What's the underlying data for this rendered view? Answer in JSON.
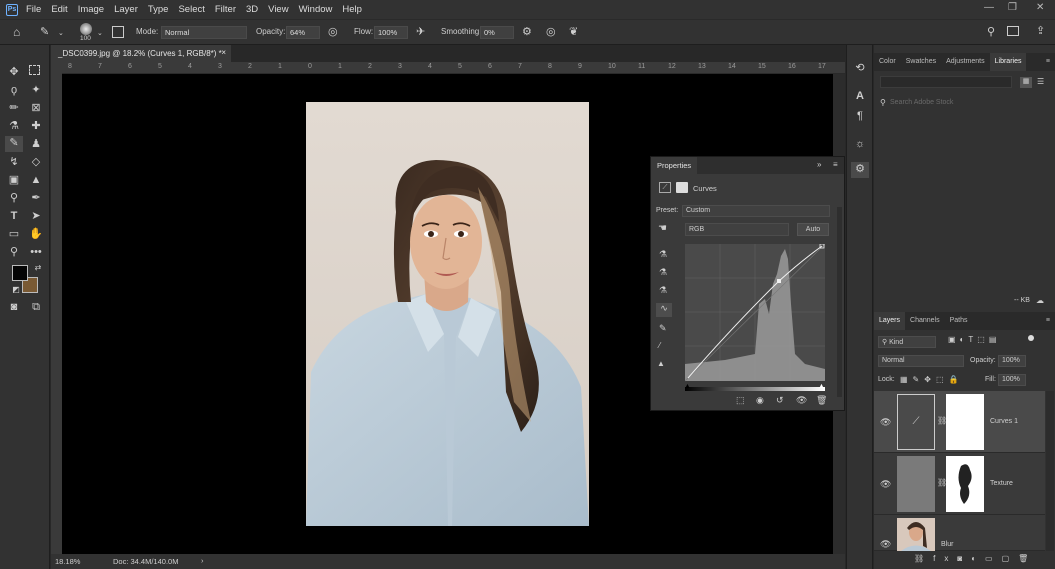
{
  "menu": {
    "logo": "Ps",
    "items": [
      "File",
      "Edit",
      "Image",
      "Layer",
      "Type",
      "Select",
      "Filter",
      "3D",
      "View",
      "Window",
      "Help"
    ],
    "window_controls": [
      "—",
      "❐",
      "✕"
    ]
  },
  "options": {
    "brush_size": "100",
    "mode_label": "Mode:",
    "mode_value": "Normal",
    "opacity_label": "Opacity:",
    "opacity_value": "64%",
    "flow_label": "Flow:",
    "flow_value": "100%",
    "smoothing_label": "Smoothing:",
    "smoothing_value": "0%"
  },
  "document": {
    "tab_label": "_DSC0399.jpg @ 18.2% (Curves 1, RGB/8*) *",
    "tab_close": "×",
    "ruler_ticks": [
      "8",
      "7",
      "6",
      "5",
      "4",
      "3",
      "2",
      "1",
      "0",
      "1",
      "2",
      "3",
      "4",
      "5",
      "6",
      "7",
      "8",
      "9",
      "10",
      "11",
      "12",
      "13",
      "14",
      "15",
      "16",
      "17"
    ],
    "zoom": "18.18%",
    "doc_info": "Doc: 34.4M/140.0M",
    "status_arrow": "›"
  },
  "properties": {
    "title": "Properties",
    "adjustment_label": "Curves",
    "preset_label": "Preset:",
    "preset_value": "Custom",
    "channel_value": "RGB",
    "auto_button": "Auto"
  },
  "libraries_panel": {
    "tabs": [
      "Color",
      "Swatches",
      "Adjustments",
      "Libraries"
    ],
    "active_tab": "Libraries",
    "search_placeholder": "Search Adobe Stock",
    "size_label": "-- KB"
  },
  "layers_panel": {
    "tabs": [
      "Layers",
      "Channels",
      "Paths"
    ],
    "active_tab": "Layers",
    "filter_kind": "Kind",
    "blend_mode": "Normal",
    "opacity_label": "Opacity:",
    "opacity_value": "100%",
    "lock_label": "Lock:",
    "fill_label": "Fill:",
    "fill_value": "100%",
    "layers": [
      {
        "name": "Curves 1"
      },
      {
        "name": "Texture"
      },
      {
        "name": "Blur"
      }
    ]
  },
  "colors": {
    "foreground": "#050505",
    "background": "#7a5a34",
    "accent": "#6fb2ff"
  }
}
